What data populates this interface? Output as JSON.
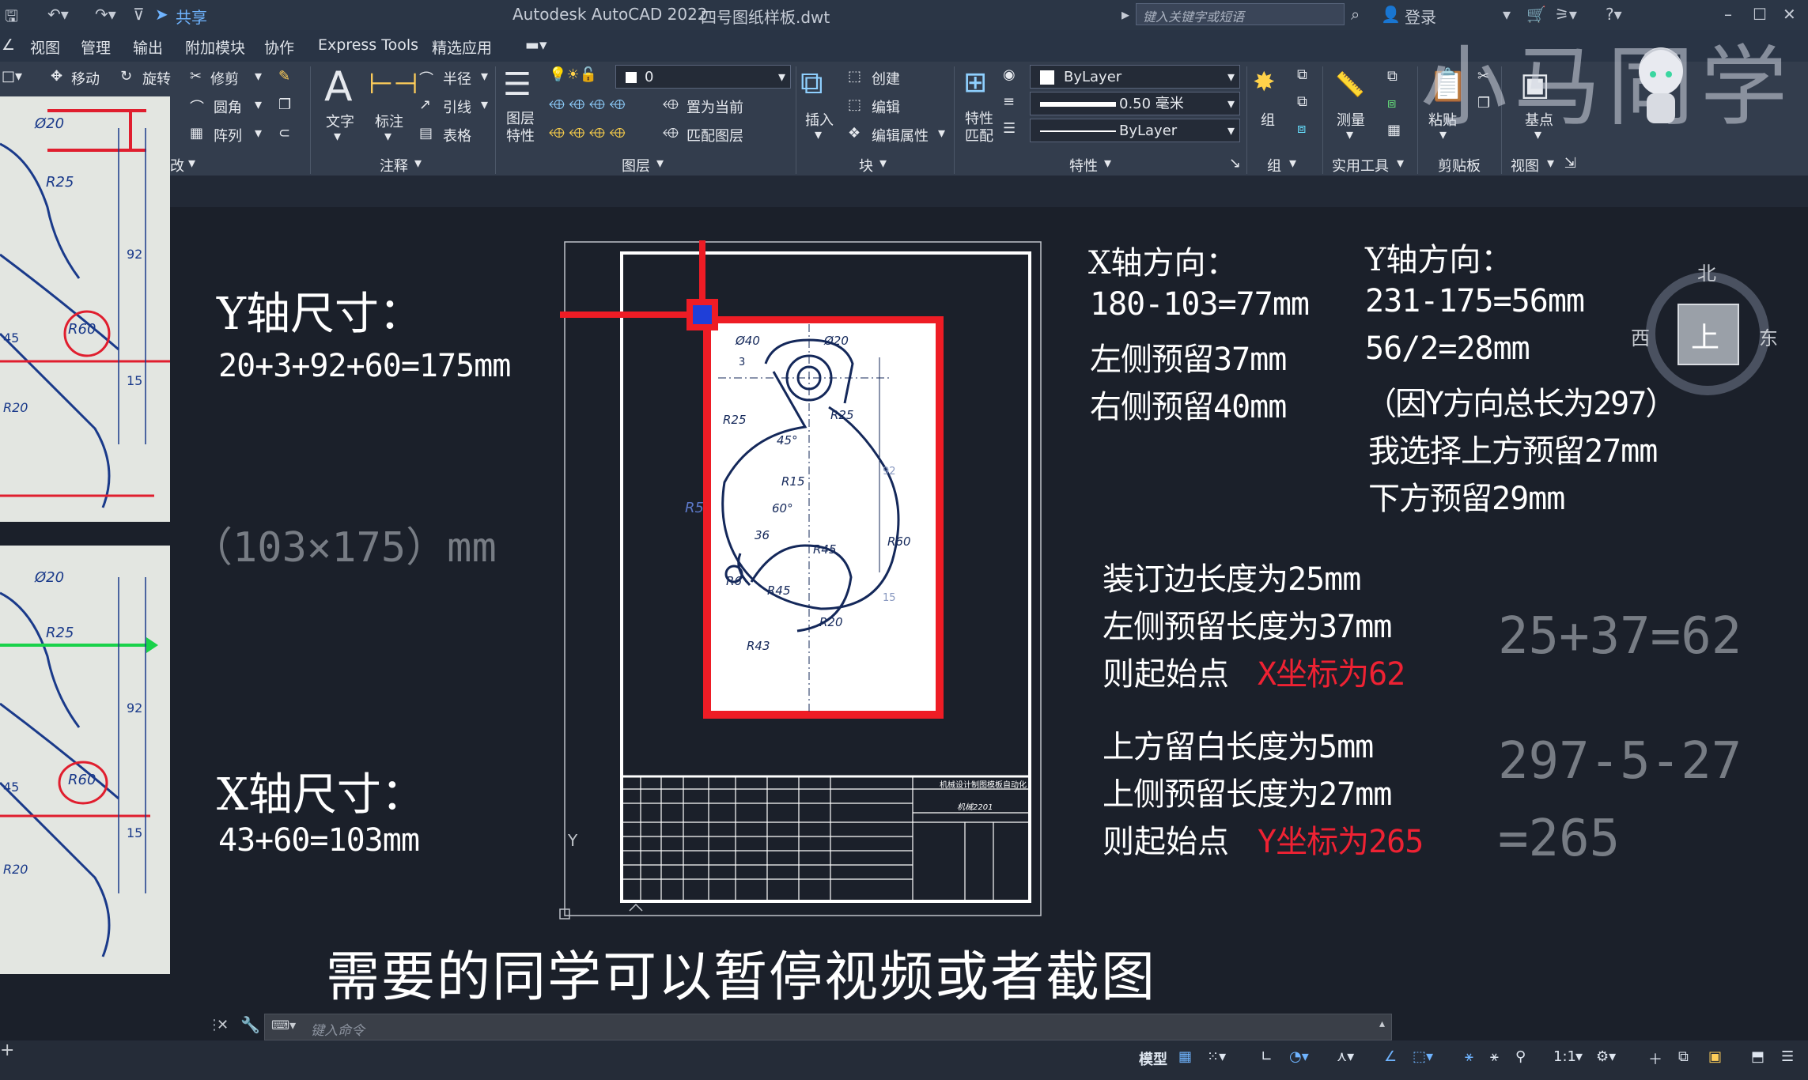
{
  "title": {
    "app": "Autodesk AutoCAD 2022",
    "file": "四号图纸样板.dwt",
    "share": "共享",
    "search_placeholder": "键入关键字或短语",
    "login": "登录"
  },
  "menu": [
    "视图",
    "管理",
    "输出",
    "附加模块",
    "协作",
    "Express Tools",
    "精选应用"
  ],
  "ribbon": {
    "modify": {
      "move": "移动",
      "rotate": "旋转",
      "trim": "修剪",
      "fillet": "圆角",
      "array": "阵列",
      "panel": "改"
    },
    "annotation": {
      "text": "文字",
      "dim": "标注",
      "radius": "半径",
      "leader": "引线",
      "table": "表格",
      "panel": "注释"
    },
    "layers": {
      "props": "图层特性",
      "layer_value": "0",
      "set_current": "置为当前",
      "match": "匹配图层",
      "panel": "图层"
    },
    "block": {
      "insert": "插入",
      "create": "创建",
      "edit": "编辑",
      "edit_attr": "编辑属性",
      "panel": "块"
    },
    "properties": {
      "match": "特性匹配",
      "color": "ByLayer",
      "lineweight": "0.50 毫米",
      "linetype": "ByLayer",
      "panel": "特性"
    },
    "groups": {
      "group": "组",
      "panel": "组"
    },
    "utilities": {
      "measure": "测量",
      "panel": "实用工具"
    },
    "clipboard": {
      "paste": "粘贴",
      "panel": "剪贴板"
    },
    "view": {
      "base": "基点",
      "panel": "视图"
    }
  },
  "watermark": "小马同学",
  "viewcube": {
    "north": "北",
    "south": "",
    "west": "西",
    "east": "东",
    "top": "上"
  },
  "annotations": {
    "y_size_title": "Y轴尺寸：",
    "y_size_calc": "20+3+92+60=175mm",
    "overall": "（103×175）mm",
    "x_size_title": "X轴尺寸：",
    "x_size_calc": "43+60=103mm",
    "x_dir_title": "X轴方向：",
    "x_dir_1": "180-103=77mm",
    "x_dir_2": "左侧预留37mm",
    "x_dir_3": "右侧预留40mm",
    "y_dir_title": "Y轴方向：",
    "y_dir_1": "231-175=56mm",
    "y_dir_2": "56/2=28mm",
    "y_dir_3": "（因Y方向总长为297）",
    "y_dir_4": "我选择上方预留27mm",
    "y_dir_5": "下方预留29mm",
    "bind_1": "装订边长度为25mm",
    "bind_2": "左侧预留长度为37mm",
    "bind_3a": "则起始点",
    "bind_3b": "X坐标为62",
    "bind_calc": "25+37=62",
    "top_1": "上方留白长度为5mm",
    "top_2": "上侧预留长度为27mm",
    "top_3a": "则起始点",
    "top_3b": "Y坐标为265",
    "top_calc_1": "297-5-27",
    "top_calc_2": "=265",
    "subtitle": "需要的同学可以暂停视频或者截图"
  },
  "drawing_dims": [
    "Ø40",
    "Ø20",
    "R25",
    "R25",
    "45°",
    "R15",
    "60°",
    "36",
    "R45",
    "R60",
    "R6",
    "R45",
    "R20",
    "R43",
    "3",
    "92",
    "15",
    "R5"
  ],
  "photo_dims": [
    "Ø20",
    "R25",
    "R60",
    "92",
    "15",
    "R20",
    "45"
  ],
  "title_block": {
    "line1": "机械设计制图模板自动化",
    "line2": "机械2201"
  },
  "command": {
    "placeholder": "键入命令"
  },
  "status": {
    "model": "模型",
    "scale": "1:1"
  },
  "colors": {
    "accent_red": "#ee2233",
    "viewport_bg": "#1b202a",
    "ribbon_bg": "#333d4d",
    "marker_blue": "#1f3fd8"
  }
}
